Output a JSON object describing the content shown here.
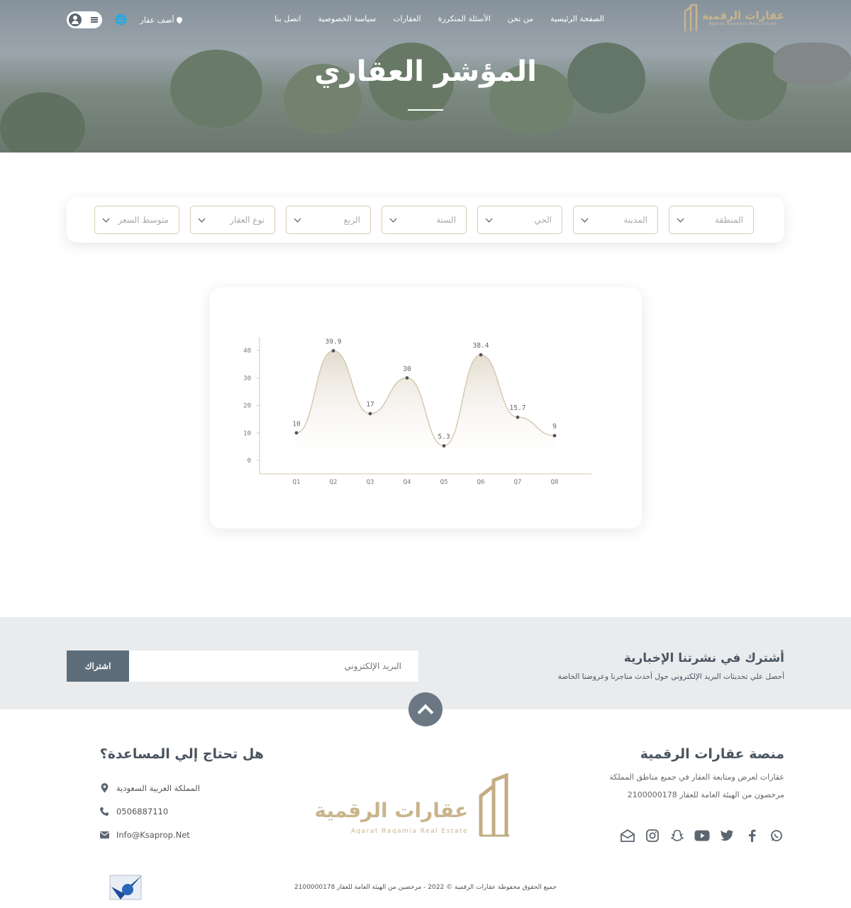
{
  "nav": {
    "logo_text": "عقارات الرقمية",
    "logo_sub": "Aqarat Raqamia Real Estate",
    "items": [
      "الصفحة الرئيسية",
      "من نحن",
      "الأسئلة المتكررة",
      "العقارات",
      "سياسة الخصوصية",
      "اتصل بنا"
    ],
    "add_property": "أضف عقار"
  },
  "hero": {
    "title": "المؤشر العقاري"
  },
  "filters": {
    "selects": [
      "المنطقة",
      "المدينة",
      "الحي",
      "السنة",
      "الربع",
      "نوع العقار",
      "متوسط السعر"
    ]
  },
  "chart_data": {
    "type": "line",
    "categories": [
      "Q1",
      "Q2",
      "Q3",
      "Q4",
      "Q5",
      "Q6",
      "Q7",
      "Q8"
    ],
    "values": [
      10,
      39.9,
      17,
      30,
      5.3,
      38.4,
      15.7,
      9
    ],
    "value_labels": [
      "10",
      "39.9",
      "17",
      "30",
      "5.3",
      "38.4",
      "15.7",
      "9"
    ],
    "ylim": [
      0,
      40
    ],
    "yticks": [
      0,
      10,
      20,
      30,
      40
    ],
    "title": "",
    "xlabel": "",
    "ylabel": "",
    "line_color": "#d4c7ad",
    "fill": "area-gradient",
    "grid": false
  },
  "newsletter": {
    "title": "أشترك في نشرتنا الإخبارية",
    "subtitle": "أحصل علي تحديثات البريد الإلكتروني حول أحدث متاجرنا وعروضنا الخاصة",
    "placeholder": "البريد الإلكتروني",
    "button": "اشتراك"
  },
  "footer": {
    "about_title": "منصة عقارات الرقمية",
    "about_text_1": "عقارات لعرض ومتابعة العقار في جميع مناطق المملكة",
    "about_text_2": "مرخصون من الهيئة العامة للعقار 2100000178",
    "logo_text": "عقارات الرقمية",
    "logo_sub": "Aqarat Raqamia Real Estate",
    "help_title": "هل تحتاج إلي المساعدة؟",
    "address": "المملكة العربية السعودية",
    "phone": "0506887110",
    "email": "Info@Ksaprop.Net",
    "copyright": "جميع الحقوق محفوظة عقارات الرقمية © 2022 - مرخصين من الهيئة العامة للعقار 2100000178",
    "social_icons": [
      "whatsapp-icon",
      "facebook-icon",
      "twitter-icon",
      "youtube-icon",
      "snapchat-icon",
      "instagram-icon",
      "mail-open-icon"
    ]
  },
  "colors": {
    "accent": "#c9b48c",
    "dark": "#5e6d7a",
    "text": "#4a5560"
  }
}
